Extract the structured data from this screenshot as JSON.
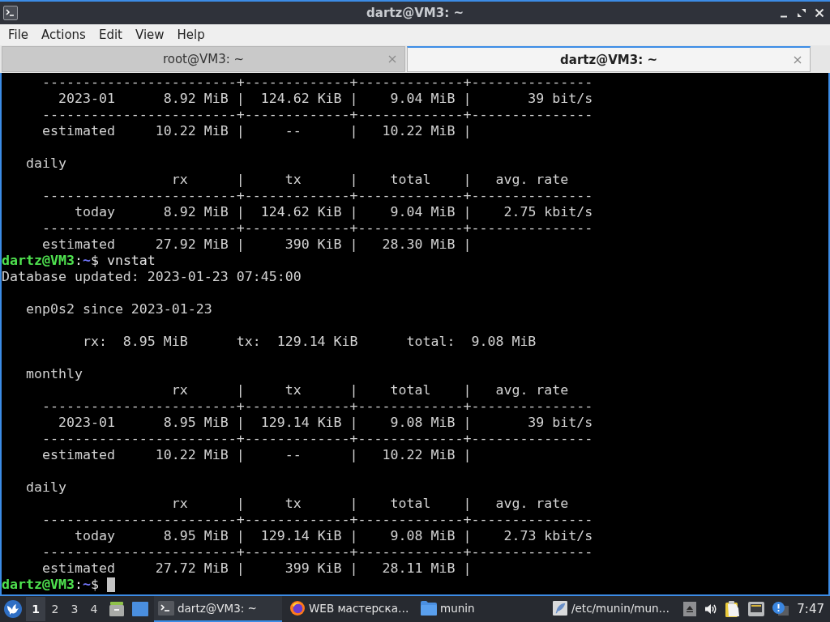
{
  "window": {
    "title": "dartz@VM3: ~"
  },
  "menu": [
    "File",
    "Actions",
    "Edit",
    "View",
    "Help"
  ],
  "tabs": [
    {
      "label": "root@VM3: ~",
      "selected": false
    },
    {
      "label": "dartz@VM3: ~",
      "selected": true
    }
  ],
  "terminal": {
    "lines": [
      {
        "kind": "text",
        "text": "     ------------------------+-------------+-------------+---------------"
      },
      {
        "kind": "text",
        "text": "       2023-01      8.92 MiB |  124.62 KiB |    9.04 MiB |       39 bit/s"
      },
      {
        "kind": "text",
        "text": "     ------------------------+-------------+-------------+---------------"
      },
      {
        "kind": "text",
        "text": "     estimated     10.22 MiB |     --      |   10.22 MiB |"
      },
      {
        "kind": "blank"
      },
      {
        "kind": "text",
        "text": "   daily"
      },
      {
        "kind": "text",
        "text": "                     rx      |     tx      |    total    |   avg. rate"
      },
      {
        "kind": "text",
        "text": "     ------------------------+-------------+-------------+---------------"
      },
      {
        "kind": "text",
        "text": "         today      8.92 MiB |  124.62 KiB |    9.04 MiB |    2.75 kbit/s"
      },
      {
        "kind": "text",
        "text": "     ------------------------+-------------+-------------+---------------"
      },
      {
        "kind": "text",
        "text": "     estimated     27.92 MiB |     390 KiB |   28.30 MiB |"
      },
      {
        "kind": "prompt",
        "user": "dartz@VM3",
        "separator": ":",
        "path": "~",
        "text": "$ vnstat",
        "cursor": false
      },
      {
        "kind": "text",
        "text": "Database updated: 2023-01-23 07:45:00"
      },
      {
        "kind": "blank"
      },
      {
        "kind": "text",
        "text": "   enp0s2 since 2023-01-23"
      },
      {
        "kind": "blank"
      },
      {
        "kind": "text",
        "text": "          rx:  8.95 MiB      tx:  129.14 KiB      total:  9.08 MiB"
      },
      {
        "kind": "blank"
      },
      {
        "kind": "text",
        "text": "   monthly"
      },
      {
        "kind": "text",
        "text": "                     rx      |     tx      |    total    |   avg. rate"
      },
      {
        "kind": "text",
        "text": "     ------------------------+-------------+-------------+---------------"
      },
      {
        "kind": "text",
        "text": "       2023-01      8.95 MiB |  129.14 KiB |    9.08 MiB |       39 bit/s"
      },
      {
        "kind": "text",
        "text": "     ------------------------+-------------+-------------+---------------"
      },
      {
        "kind": "text",
        "text": "     estimated     10.22 MiB |     --      |   10.22 MiB |"
      },
      {
        "kind": "blank"
      },
      {
        "kind": "text",
        "text": "   daily"
      },
      {
        "kind": "text",
        "text": "                     rx      |     tx      |    total    |   avg. rate"
      },
      {
        "kind": "text",
        "text": "     ------------------------+-------------+-------------+---------------"
      },
      {
        "kind": "text",
        "text": "         today      8.95 MiB |  129.14 KiB |    9.08 MiB |    2.73 kbit/s"
      },
      {
        "kind": "text",
        "text": "     ------------------------+-------------+-------------+---------------"
      },
      {
        "kind": "text",
        "text": "     estimated     27.72 MiB |     399 KiB |   28.11 MiB |"
      },
      {
        "kind": "prompt",
        "user": "dartz@VM3",
        "separator": ":",
        "path": "~",
        "text": "$",
        "cursor": true
      }
    ]
  },
  "taskbar": {
    "workspaces": [
      {
        "label": "1",
        "selected": true
      },
      {
        "label": "2",
        "selected": false
      },
      {
        "label": "3",
        "selected": false
      },
      {
        "label": "4",
        "selected": false
      }
    ],
    "tasks": [
      {
        "kind": "terminal",
        "label": "dartz@VM3: ~",
        "selected": true
      },
      {
        "kind": "browser",
        "label": "WEB мастерска…",
        "selected": false
      },
      {
        "kind": "folder",
        "label": "munin",
        "selected": false
      },
      {
        "kind": "editor",
        "label": "/etc/munin/mun…",
        "selected": false
      }
    ],
    "clock": "7:47"
  }
}
